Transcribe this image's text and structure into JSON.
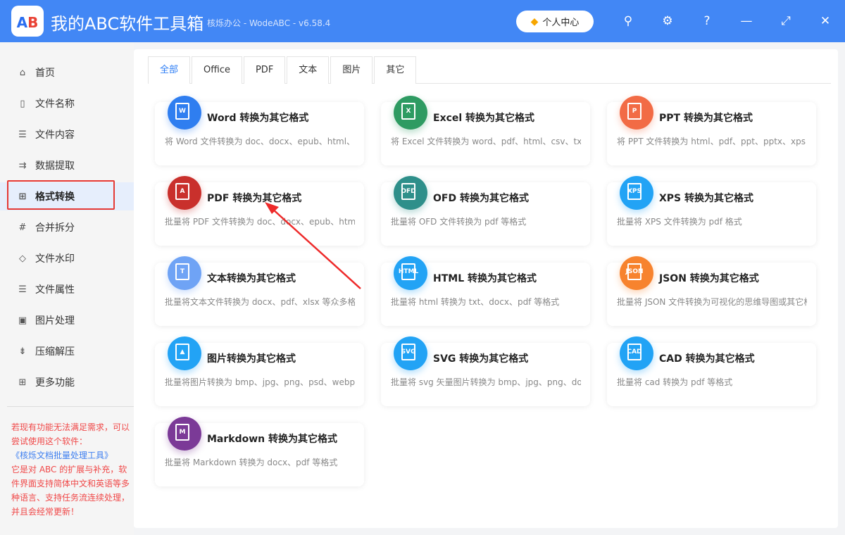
{
  "header": {
    "logo_text": "AB",
    "title": "我的ABC软件工具箱",
    "subtitle": "核烁办公 - WodeABC - v6.58.4",
    "user_center": "个人中心"
  },
  "sidebar": {
    "items": [
      {
        "label": "首页",
        "icon": "home-icon",
        "glyph": "⌂"
      },
      {
        "label": "文件名称",
        "icon": "file-name-icon",
        "glyph": "▯"
      },
      {
        "label": "文件内容",
        "icon": "file-content-icon",
        "glyph": "☰"
      },
      {
        "label": "数据提取",
        "icon": "data-extract-icon",
        "glyph": "⇉"
      },
      {
        "label": "格式转换",
        "icon": "format-convert-icon",
        "glyph": "⊞"
      },
      {
        "label": "合并拆分",
        "icon": "merge-split-icon",
        "glyph": "#"
      },
      {
        "label": "文件水印",
        "icon": "watermark-icon",
        "glyph": "◇"
      },
      {
        "label": "文件属性",
        "icon": "file-attr-icon",
        "glyph": "☰"
      },
      {
        "label": "图片处理",
        "icon": "image-icon",
        "glyph": "▣"
      },
      {
        "label": "压缩解压",
        "icon": "compress-icon",
        "glyph": "⇟"
      },
      {
        "label": "更多功能",
        "icon": "more-icon",
        "glyph": "⊞"
      }
    ],
    "active": "格式转换",
    "note_1": "若现有功能无法满足需求，可以尝试使用这个软件：",
    "note_link": "《核烁文档批量处理工具》",
    "note_2": "它是对 ABC 的扩展与补充，软件界面支持简体中文和英语等多种语言、支持任务流连续处理，并且会经常更新！"
  },
  "tabs": [
    "全部",
    "Office",
    "PDF",
    "文本",
    "图片",
    "其它"
  ],
  "cards": [
    {
      "title": "Word 转换为其它格式",
      "desc": "将 Word 文件转换为 doc、docx、epub、html、pdf",
      "badge": "W",
      "color": "#2f7ef0"
    },
    {
      "title": "Excel 转换为其它格式",
      "desc": "将 Excel 文件转换为 word、pdf、html、csv、txt、s",
      "badge": "X",
      "color": "#2e9b62"
    },
    {
      "title": "PPT 转换为其它格式",
      "desc": "将 PPT 文件转换为 html、pdf、ppt、pptx、xps 等格式",
      "badge": "P",
      "color": "#f26b45"
    },
    {
      "title": "PDF 转换为其它格式",
      "desc": "批量将 PDF 文件转换为 doc、docx、epub、html、",
      "badge": "A",
      "color": "#c9302c"
    },
    {
      "title": "OFD 转换为其它格式",
      "desc": "批量将 OFD 文件转换为 pdf 等格式",
      "badge": "OFD",
      "color": "#2e8f8a"
    },
    {
      "title": "XPS 转换为其它格式",
      "desc": "批量将 XPS 文件转换为 pdf 格式",
      "badge": "XPS",
      "color": "#22a3f5"
    },
    {
      "title": "文本转换为其它格式",
      "desc": "批量将文本文件转换为 docx、pdf、xlsx 等众多格式",
      "badge": "T",
      "color": "#6fa3f5"
    },
    {
      "title": "HTML 转换为其它格式",
      "desc": "批量将 html 转换为 txt、docx、pdf 等格式",
      "badge": "HTML",
      "color": "#22a3f5"
    },
    {
      "title": "JSON 转换为其它格式",
      "desc": "批量将 JSON 文件转换为可视化的思维导图或其它格式",
      "badge": "JSON",
      "color": "#f7832e"
    },
    {
      "title": "图片转换为其它格式",
      "desc": "批量将图片转换为 bmp、jpg、png、psd、webp、",
      "badge": "▲",
      "color": "#22a3f5"
    },
    {
      "title": "SVG 转换为其它格式",
      "desc": "批量将 svg 矢量图片转换为 bmp、jpg、png、docx",
      "badge": "SVG",
      "color": "#22a3f5"
    },
    {
      "title": "CAD 转换为其它格式",
      "desc": "批量将 cad 转换为 pdf 等格式",
      "badge": "CAD",
      "color": "#22a3f5"
    },
    {
      "title": "Markdown 转换为其它格式",
      "desc": "批量将 Markdown 转换为 docx、pdf 等格式",
      "badge": "M",
      "color": "#7b3a97"
    }
  ]
}
